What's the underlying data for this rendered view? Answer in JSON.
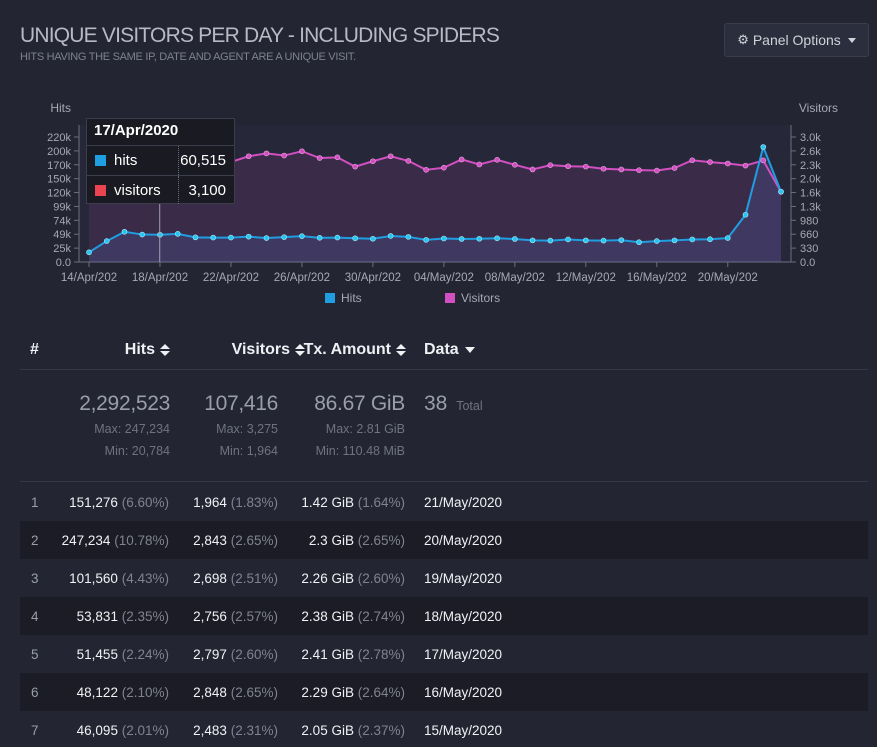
{
  "panel": {
    "title": "UNIQUE VISITORS PER DAY - INCLUDING SPIDERS",
    "subtitle": "HITS HAVING THE SAME IP, DATE AND AGENT ARE A UNIQUE VISIT.",
    "options_label": "Panel Options"
  },
  "colors": {
    "hits": "#1f9ee2",
    "visitors": "#d24fc2",
    "background": "#232532"
  },
  "chart_data": {
    "type": "line",
    "left_axis_label": "Hits",
    "right_axis_label": "Visitors",
    "left_ticks": [
      "0.0",
      "25k",
      "49k",
      "74k",
      "99k",
      "120k",
      "150k",
      "170k",
      "200k",
      "220k"
    ],
    "right_ticks": [
      "0.0",
      "330",
      "660",
      "980",
      "1.3k",
      "1.6k",
      "2.0k",
      "2.3k",
      "2.6k",
      "3.0k"
    ],
    "left_range": [
      0,
      247234
    ],
    "right_range": [
      0,
      3275
    ],
    "x_tick_labels": [
      "14/Apr/202",
      "18/Apr/202",
      "22/Apr/202",
      "26/Apr/202",
      "30/Apr/202",
      "04/May/202",
      "08/May/202",
      "12/May/202",
      "16/May/202",
      "20/May/202"
    ],
    "x_tick_index": [
      0,
      4,
      8,
      12,
      16,
      20,
      24,
      28,
      32,
      36
    ],
    "legend": [
      {
        "name": "Hits",
        "color": "#1f9ee2"
      },
      {
        "name": "Visitors",
        "color": "#d24fc2"
      }
    ],
    "series": [
      {
        "name": "hits",
        "values": [
          20784,
          45000,
          65000,
          59000,
          58500,
          60515,
          53000,
          52500,
          52500,
          54500,
          51500,
          53500,
          55500,
          52000,
          52500,
          51000,
          50000,
          56000,
          54000,
          47500,
          50500,
          49500,
          50000,
          51000,
          49500,
          46500,
          46000,
          48500,
          46500,
          46000,
          47000,
          42500,
          45000,
          46500,
          48500,
          49000,
          51455,
          101560,
          247234,
          151276
        ]
      },
      {
        "name": "visitors",
        "values": [
          2600,
          2750,
          2810,
          2790,
          2750,
          2800,
          2760,
          2950,
          2800,
          2960,
          3040,
          2980,
          3100,
          2910,
          2930,
          2670,
          2820,
          2960,
          2830,
          2580,
          2640,
          2870,
          2730,
          2860,
          2720,
          2590,
          2710,
          2680,
          2670,
          2610,
          2590,
          2570,
          2560,
          2630,
          2848,
          2797,
          2756,
          2698,
          2843,
          1964
        ]
      }
    ],
    "tooltip": {
      "date": "17/Apr/2020",
      "index": 5,
      "rows": [
        {
          "label": "hits",
          "value": "60,515",
          "color": "#1f9ee2"
        },
        {
          "label": "visitors",
          "value": "3,100",
          "color": "#e9444f"
        }
      ]
    }
  },
  "table": {
    "headers": {
      "num": "#",
      "hits": "Hits",
      "visitors": "Visitors",
      "tx": "Tx. Amount",
      "data": "Data"
    },
    "totals": {
      "hits": {
        "value": "2,292,523",
        "max": "Max: 247,234",
        "min": "Min: 20,784"
      },
      "visitors": {
        "value": "107,416",
        "max": "Max: 3,275",
        "min": "Min: 1,964"
      },
      "tx": {
        "value": "86.67 GiB",
        "max": "Max: 2.81 GiB",
        "min": "Min: 110.48 MiB"
      },
      "data": {
        "value": "38",
        "label": "Total"
      }
    },
    "rows": [
      {
        "num": "1",
        "hits": "151,276",
        "hits_pct": "(6.60%)",
        "visitors": "1,964",
        "visitors_pct": "(1.83%)",
        "tx": "1.42 GiB",
        "tx_pct": "(1.64%)",
        "data": "21/May/2020"
      },
      {
        "num": "2",
        "hits": "247,234",
        "hits_pct": "(10.78%)",
        "visitors": "2,843",
        "visitors_pct": "(2.65%)",
        "tx": "2.3 GiB",
        "tx_pct": "(2.65%)",
        "data": "20/May/2020"
      },
      {
        "num": "3",
        "hits": "101,560",
        "hits_pct": "(4.43%)",
        "visitors": "2,698",
        "visitors_pct": "(2.51%)",
        "tx": "2.26 GiB",
        "tx_pct": "(2.60%)",
        "data": "19/May/2020"
      },
      {
        "num": "4",
        "hits": "53,831",
        "hits_pct": "(2.35%)",
        "visitors": "2,756",
        "visitors_pct": "(2.57%)",
        "tx": "2.38 GiB",
        "tx_pct": "(2.74%)",
        "data": "18/May/2020"
      },
      {
        "num": "5",
        "hits": "51,455",
        "hits_pct": "(2.24%)",
        "visitors": "2,797",
        "visitors_pct": "(2.60%)",
        "tx": "2.41 GiB",
        "tx_pct": "(2.78%)",
        "data": "17/May/2020"
      },
      {
        "num": "6",
        "hits": "48,122",
        "hits_pct": "(2.10%)",
        "visitors": "2,848",
        "visitors_pct": "(2.65%)",
        "tx": "2.29 GiB",
        "tx_pct": "(2.64%)",
        "data": "16/May/2020"
      },
      {
        "num": "7",
        "hits": "46,095",
        "hits_pct": "(2.01%)",
        "visitors": "2,483",
        "visitors_pct": "(2.31%)",
        "tx": "2.05 GiB",
        "tx_pct": "(2.37%)",
        "data": "15/May/2020"
      }
    ]
  }
}
